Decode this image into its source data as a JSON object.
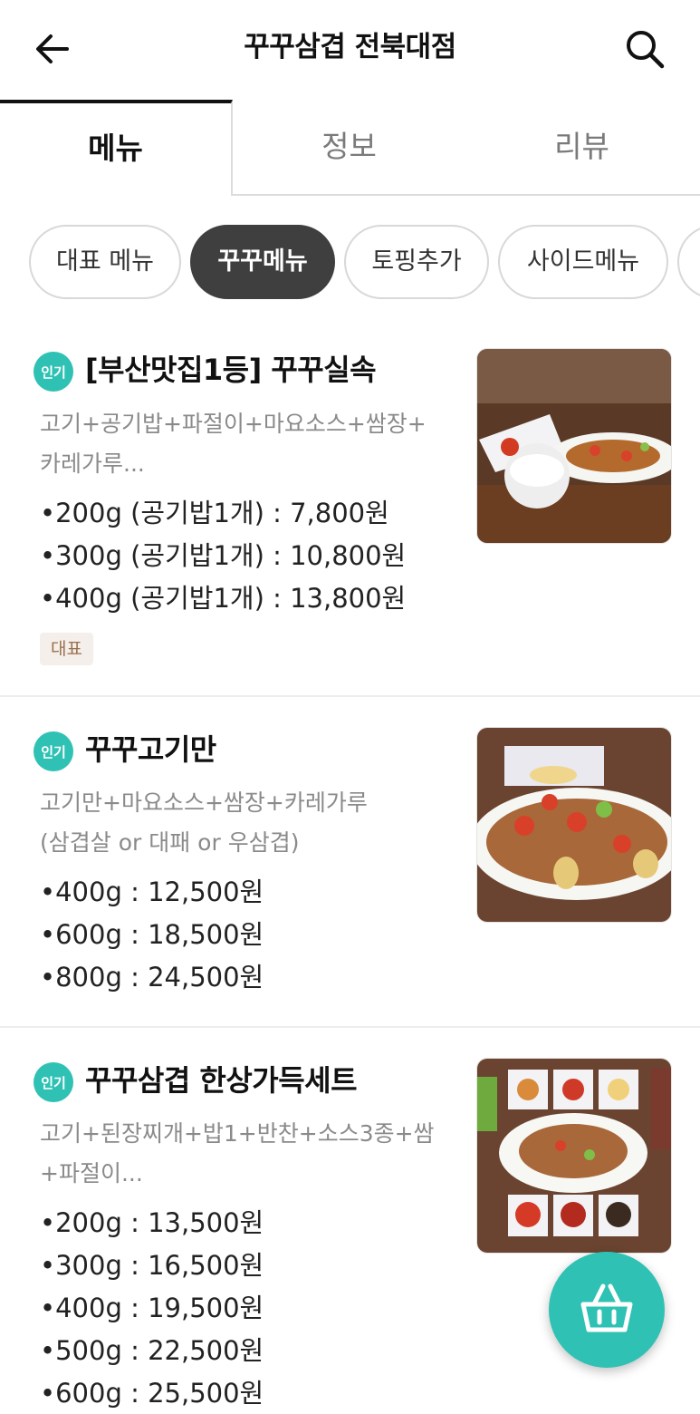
{
  "header": {
    "title": "꾸꾸삼겹 전북대점",
    "back_icon": "arrow-left-icon",
    "search_icon": "search-icon"
  },
  "tabs": [
    {
      "label": "메뉴",
      "active": true
    },
    {
      "label": "정보",
      "active": false
    },
    {
      "label": "리뷰",
      "active": false
    }
  ],
  "categories": [
    {
      "label": "대표 메뉴",
      "active": false
    },
    {
      "label": "꾸꾸메뉴",
      "active": true
    },
    {
      "label": "토핑추가",
      "active": false
    },
    {
      "label": "사이드메뉴",
      "active": false
    }
  ],
  "popular_badge": "인기",
  "menu_items": [
    {
      "name": "[부산맛집1등] 꾸꾸실속",
      "desc_lines": [
        "고기+공기밥+파절이+마요소스+쌈장+",
        "카레가루..."
      ],
      "prices": [
        "•200g (공기밥1개) : 7,800원",
        "•300g (공기밥1개) : 10,800원",
        "•400g (공기밥1개) : 13,800원"
      ],
      "tag": "대표"
    },
    {
      "name": "꾸꾸고기만",
      "desc_lines": [
        "고기만+마요소스+쌈장+카레가루",
        "(삼겹살 or 대패 or 우삼겹)"
      ],
      "prices": [
        "•400g : 12,500원",
        "•600g : 18,500원",
        "•800g : 24,500원"
      ]
    },
    {
      "name": "꾸꾸삼겹 한상가득세트",
      "desc_lines": [
        "고기+된장찌개+밥1+반찬+소스3종+쌈",
        "+파절이..."
      ],
      "prices": [
        "•200g : 13,500원",
        "•300g : 16,500원",
        "•400g : 19,500원",
        "•500g : 22,500원",
        "•600g : 25,500원"
      ]
    }
  ],
  "cart": {
    "icon": "basket-icon"
  },
  "colors": {
    "accent": "#2fc2b4",
    "active_chip": "#3f3f3f",
    "tag_text": "#9a6e4c",
    "tag_bg": "#f4efea"
  }
}
